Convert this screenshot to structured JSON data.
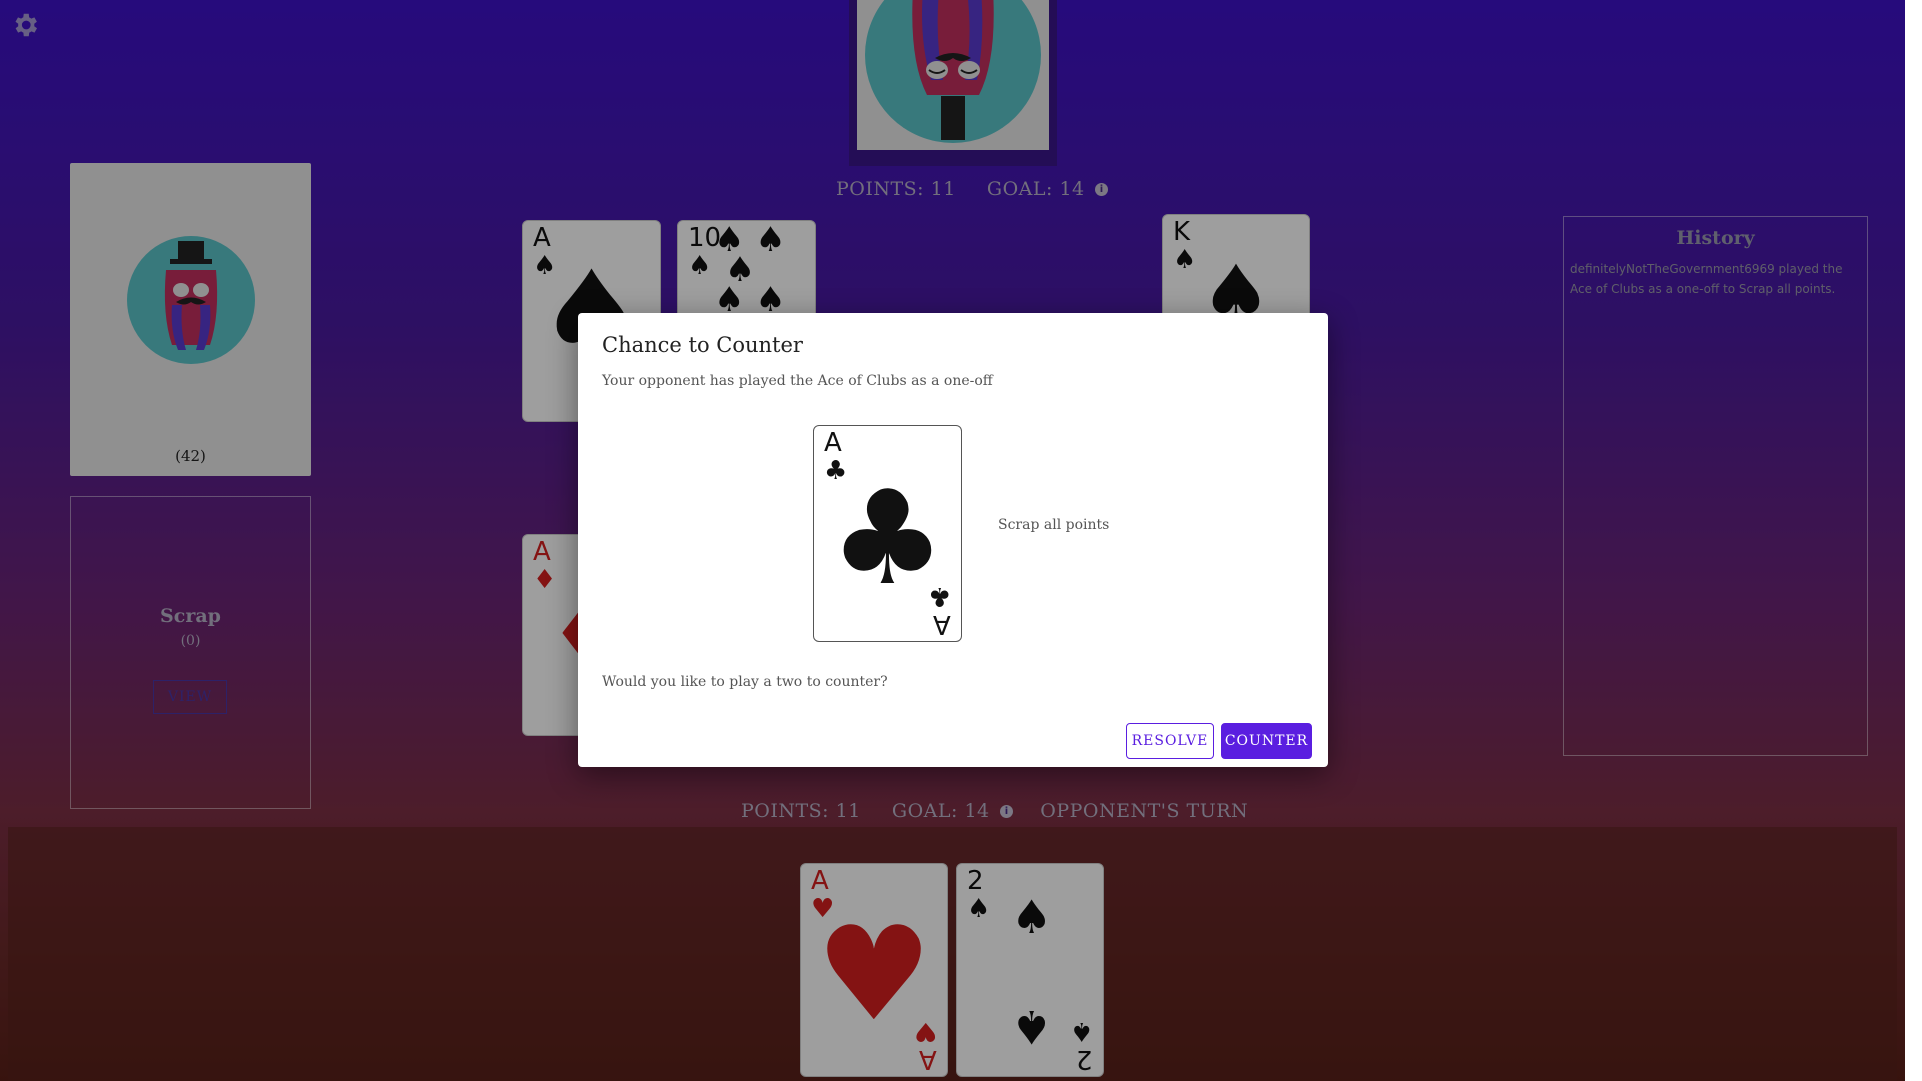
{
  "settings": {
    "icon": "gear-icon"
  },
  "opponent": {
    "avatar": "pink-octopus-avatar",
    "points_label": "POINTS: 11",
    "goal_label": "GOAL: 14",
    "info_icon": "i"
  },
  "deck": {
    "count": "(42)",
    "avatar": "octopus-top-hat-avatar"
  },
  "scrap": {
    "title": "Scrap",
    "count": "(0)",
    "view_label": "VIEW"
  },
  "history": {
    "title": "History",
    "entries": [
      "definitelyNotTheGovernment6969 played the Ace of Clubs as a one-off to Scrap all points."
    ]
  },
  "opponent_points_cards": [
    {
      "rank": "A",
      "suit": "♠",
      "color": "black"
    },
    {
      "rank": "10",
      "suit": "♠",
      "color": "black"
    }
  ],
  "opponent_royal_cards": [
    {
      "rank": "K",
      "suit": "♠",
      "color": "black"
    }
  ],
  "player_points_cards": [
    {
      "rank": "A",
      "suit": "♦",
      "color": "red"
    }
  ],
  "player": {
    "points_label": "POINTS: 11",
    "goal_label": "GOAL: 14",
    "info_icon": "i",
    "turn_label": "OPPONENT'S TURN",
    "hand": [
      {
        "rank": "A",
        "suit": "♥",
        "color": "red"
      },
      {
        "rank": "2",
        "suit": "♠",
        "color": "black"
      }
    ]
  },
  "modal": {
    "title": "Chance to Counter",
    "subtitle": "Your opponent has played the Ace of Clubs as a one-off",
    "card": {
      "rank": "A",
      "suit": "♣",
      "color": "black"
    },
    "effect": "Scrap all points",
    "question": "Would you like to play a two to counter?",
    "resolve_label": "RESOLVE",
    "counter_label": "COUNTER"
  },
  "colors": {
    "accent": "#5a1ee0",
    "bg_top": "#3e12c9",
    "bg_bottom": "#5a2018"
  }
}
